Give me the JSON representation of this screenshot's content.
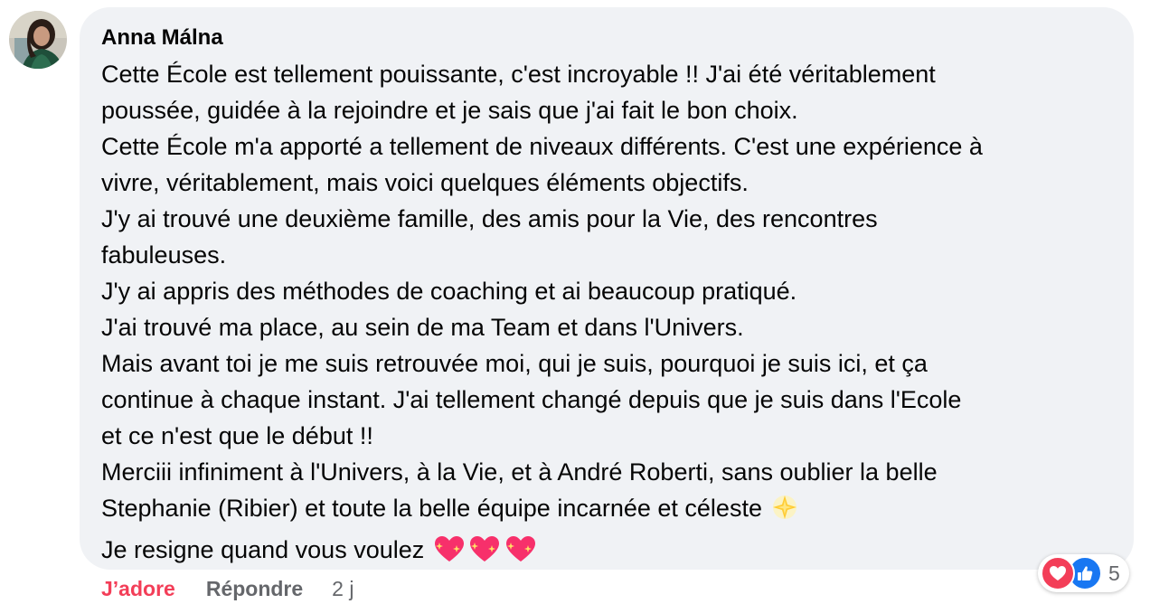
{
  "comment": {
    "author": "Anna Málna",
    "lines": [
      "Cette École est tellement pouissante, c'est incroyable !! J'ai été véritablement",
      "poussée, guidée à la rejoindre et je sais que j'ai fait le bon choix.",
      "Cette École m'a apporté a tellement de niveaux différents. C'est une expérience à",
      "vivre, véritablement, mais voici quelques éléments objectifs.",
      "J'y ai trouvé une deuxième famille, des amis pour la Vie, des rencontres",
      "fabuleuses.",
      "J'y ai appris des méthodes de coaching et ai beaucoup pratiqué.",
      "J'ai trouvé ma place, au sein de ma Team et dans l'Univers.",
      "Mais avant toi je me suis retrouvée moi, qui je suis, pourquoi je suis ici, et ça",
      "continue à chaque instant. J'ai tellement changé depuis que je suis dans l'Ecole",
      "et ce n'est que le début !!",
      "Merciii infiniment à l'Univers, à la Vie, et à André Roberti, sans oublier la belle",
      "Stephanie (Ribier) et toute la belle équipe incarnée et céleste",
      "Je resigne quand vous voulez"
    ],
    "line13_emoji": "glowing-star-emoji",
    "line14_emoji": "sparkling-heart-emoji"
  },
  "actions": {
    "like_label": "J’adore",
    "reply_label": "Répondre",
    "time": "2 j"
  },
  "reactions": {
    "icons": [
      "heart-reaction-icon",
      "like-reaction-icon"
    ],
    "count": "5"
  },
  "colors": {
    "bubble_bg": "#f0f2f5",
    "love_red": "#f33e58",
    "like_blue": "#1877f2",
    "secondary_text": "#65676b"
  }
}
